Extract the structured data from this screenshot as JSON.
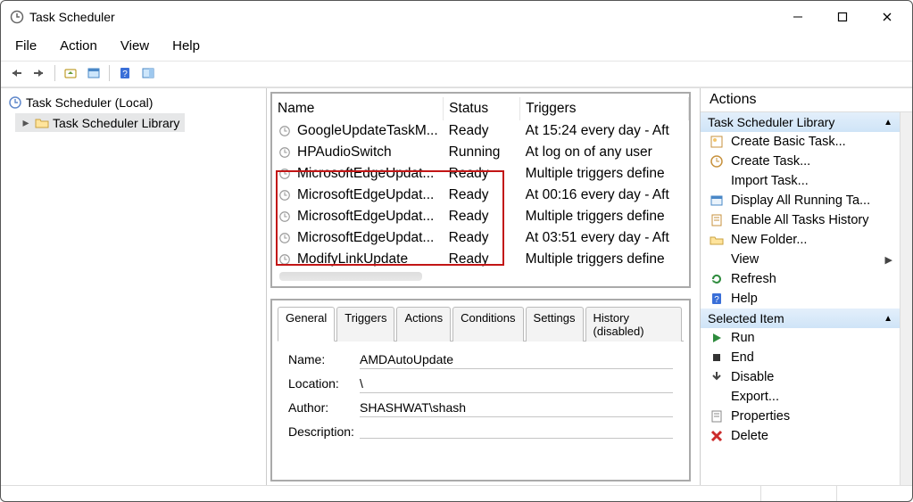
{
  "title": "Task Scheduler",
  "menu": {
    "file": "File",
    "action": "Action",
    "view": "View",
    "help": "Help"
  },
  "tree": {
    "root": "Task Scheduler (Local)",
    "child": "Task Scheduler Library"
  },
  "columns": {
    "name": "Name",
    "status": "Status",
    "triggers": "Triggers"
  },
  "tasks": [
    {
      "name": "GoogleUpdateTaskM...",
      "status": "Ready",
      "triggers": "At 15:24 every day - Aft"
    },
    {
      "name": "HPAudioSwitch",
      "status": "Running",
      "triggers": "At log on of any user"
    },
    {
      "name": "MicrosoftEdgeUpdat...",
      "status": "Ready",
      "triggers": "Multiple triggers define"
    },
    {
      "name": "MicrosoftEdgeUpdat...",
      "status": "Ready",
      "triggers": "At 00:16 every day - Aft"
    },
    {
      "name": "MicrosoftEdgeUpdat...",
      "status": "Ready",
      "triggers": "Multiple triggers define"
    },
    {
      "name": "MicrosoftEdgeUpdat...",
      "status": "Ready",
      "triggers": "At 03:51 every day - Aft"
    },
    {
      "name": "ModifyLinkUpdate",
      "status": "Ready",
      "triggers": "Multiple triggers define"
    }
  ],
  "tabs": {
    "general": "General",
    "triggers": "Triggers",
    "actions": "Actions",
    "conditions": "Conditions",
    "settings": "Settings",
    "history": "History (disabled)"
  },
  "detail": {
    "labels": {
      "name": "Name:",
      "location": "Location:",
      "author": "Author:",
      "description": "Description:"
    },
    "name": "AMDAutoUpdate",
    "location": "\\",
    "author": "SHASHWAT\\shash",
    "description": ""
  },
  "actionsTitle": "Actions",
  "section1": {
    "title": "Task Scheduler Library",
    "items": {
      "create_basic": "Create Basic Task...",
      "create_task": "Create Task...",
      "import": "Import Task...",
      "display_running": "Display All Running Ta...",
      "enable_history": "Enable All Tasks History",
      "new_folder": "New Folder...",
      "view": "View",
      "refresh": "Refresh",
      "help": "Help"
    }
  },
  "section2": {
    "title": "Selected Item",
    "items": {
      "run": "Run",
      "end": "End",
      "disable": "Disable",
      "export": "Export...",
      "properties": "Properties",
      "delete": "Delete"
    }
  }
}
